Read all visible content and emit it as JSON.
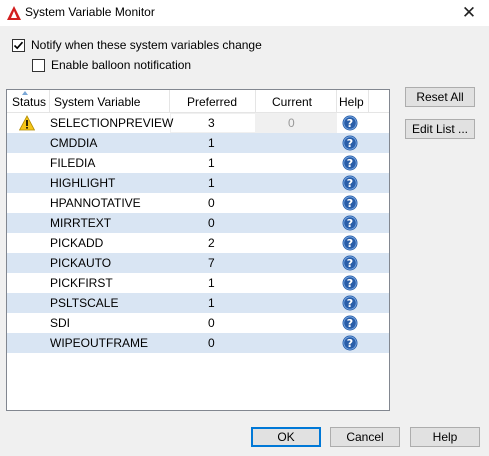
{
  "window": {
    "title": "System Variable Monitor",
    "close_symbol": "✕"
  },
  "options": {
    "notify_label": "Notify when these system variables change",
    "notify_checked": true,
    "balloon_label": "Enable balloon notification",
    "balloon_checked": false
  },
  "table": {
    "headers": {
      "status": "Status",
      "variable": "System Variable",
      "preferred": "Preferred",
      "current": "Current",
      "help": "Help"
    },
    "rows": [
      {
        "status": "warning-icon",
        "name": "SELECTIONPREVIEW",
        "preferred": "3",
        "current": "0"
      },
      {
        "status": "",
        "name": "CMDDIA",
        "preferred": "1",
        "current": ""
      },
      {
        "status": "",
        "name": "FILEDIA",
        "preferred": "1",
        "current": ""
      },
      {
        "status": "",
        "name": "HIGHLIGHT",
        "preferred": "1",
        "current": ""
      },
      {
        "status": "",
        "name": "HPANNOTATIVE",
        "preferred": "0",
        "current": ""
      },
      {
        "status": "",
        "name": "MIRRTEXT",
        "preferred": "0",
        "current": ""
      },
      {
        "status": "",
        "name": "PICKADD",
        "preferred": "2",
        "current": ""
      },
      {
        "status": "",
        "name": "PICKAUTO",
        "preferred": "7",
        "current": ""
      },
      {
        "status": "",
        "name": "PICKFIRST",
        "preferred": "1",
        "current": ""
      },
      {
        "status": "",
        "name": "PSLTSCALE",
        "preferred": "1",
        "current": ""
      },
      {
        "status": "",
        "name": "SDI",
        "preferred": "0",
        "current": ""
      },
      {
        "status": "",
        "name": "WIPEOUTFRAME",
        "preferred": "0",
        "current": ""
      }
    ]
  },
  "side_buttons": {
    "reset_all": "Reset All",
    "edit_list": "Edit List ..."
  },
  "footer_buttons": {
    "ok": "OK",
    "cancel": "Cancel",
    "help": "Help"
  },
  "colors": {
    "alt_row": "#d9e5f3",
    "help_icon": "#2a5ea8",
    "warning": "#f5c518",
    "focus": "#0078d7"
  }
}
